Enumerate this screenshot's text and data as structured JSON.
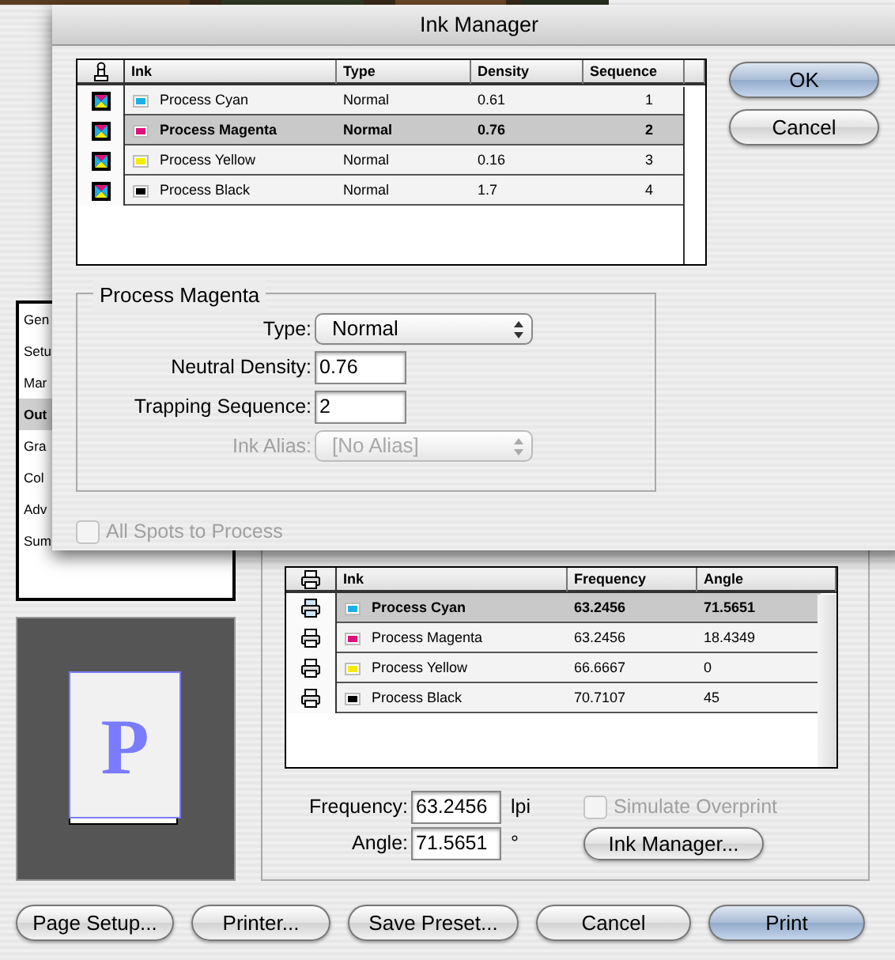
{
  "print_dialog": {
    "sidebar": [
      {
        "label": "Gen",
        "selected": false
      },
      {
        "label": "Setu",
        "selected": false
      },
      {
        "label": "Mar",
        "selected": false
      },
      {
        "label": "Out",
        "selected": true
      },
      {
        "label": "Gra",
        "selected": false
      },
      {
        "label": "Col",
        "selected": false
      },
      {
        "label": "Adv",
        "selected": false
      },
      {
        "label": "Sum",
        "selected": false
      }
    ],
    "preview": {
      "page_letter": "P"
    },
    "inks": {
      "columns": [
        "Ink",
        "Frequency",
        "Angle"
      ],
      "rows": [
        {
          "name": "Process Cyan",
          "color": "#1ab0e8",
          "frequency": "63.2456",
          "angle": "71.5651",
          "selected": true,
          "print": true
        },
        {
          "name": "Process Magenta",
          "color": "#e0107a",
          "frequency": "63.2456",
          "angle": "18.4349",
          "selected": false,
          "print": true
        },
        {
          "name": "Process Yellow",
          "color": "#f5ec00",
          "frequency": "66.6667",
          "angle": "0",
          "selected": false,
          "print": true
        },
        {
          "name": "Process Black",
          "color": "#000000",
          "frequency": "70.7107",
          "angle": "45",
          "selected": false,
          "print": true
        }
      ]
    },
    "frequency": {
      "label": "Frequency:",
      "value": "63.2456",
      "unit": "lpi"
    },
    "angle": {
      "label": "Angle:",
      "value": "71.5651",
      "unit": "°"
    },
    "simulate_overprint": {
      "label": "Simulate Overprint",
      "checked": false,
      "disabled": true
    },
    "ink_manager_button": "Ink Manager...",
    "buttons": [
      {
        "label": "Page Setup...",
        "default": false
      },
      {
        "label": "Printer...",
        "default": false
      },
      {
        "label": "Save Preset...",
        "default": false
      },
      {
        "label": "Cancel",
        "default": false
      },
      {
        "label": "Print",
        "default": true
      }
    ]
  },
  "ink_manager": {
    "title": "Ink Manager",
    "columns": [
      "Ink",
      "Type",
      "Density",
      "Sequence"
    ],
    "rows": [
      {
        "name": "Process Cyan",
        "color": "#1ab0e8",
        "type": "Normal",
        "density": "0.61",
        "sequence": "1",
        "selected": false
      },
      {
        "name": "Process Magenta",
        "color": "#e0107a",
        "type": "Normal",
        "density": "0.76",
        "sequence": "2",
        "selected": true
      },
      {
        "name": "Process Yellow",
        "color": "#f5ec00",
        "type": "Normal",
        "density": "0.16",
        "sequence": "3",
        "selected": false
      },
      {
        "name": "Process Black",
        "color": "#000000",
        "type": "Normal",
        "density": "1.7",
        "sequence": "4",
        "selected": false
      }
    ],
    "buttons": [
      {
        "label": "OK",
        "default": true
      },
      {
        "label": "Cancel",
        "default": false
      }
    ],
    "detail": {
      "title": "Process Magenta",
      "type": {
        "label": "Type:",
        "value": "Normal",
        "disabled": false
      },
      "neutral_density": {
        "label": "Neutral Density:",
        "value": "0.76"
      },
      "trapping_sequence": {
        "label": "Trapping Sequence:",
        "value": "2"
      },
      "ink_alias": {
        "label": "Ink Alias:",
        "value": "[No Alias]",
        "disabled": true
      }
    },
    "all_spots_to_process": {
      "label": "All Spots to Process",
      "checked": false,
      "disabled": true
    }
  }
}
